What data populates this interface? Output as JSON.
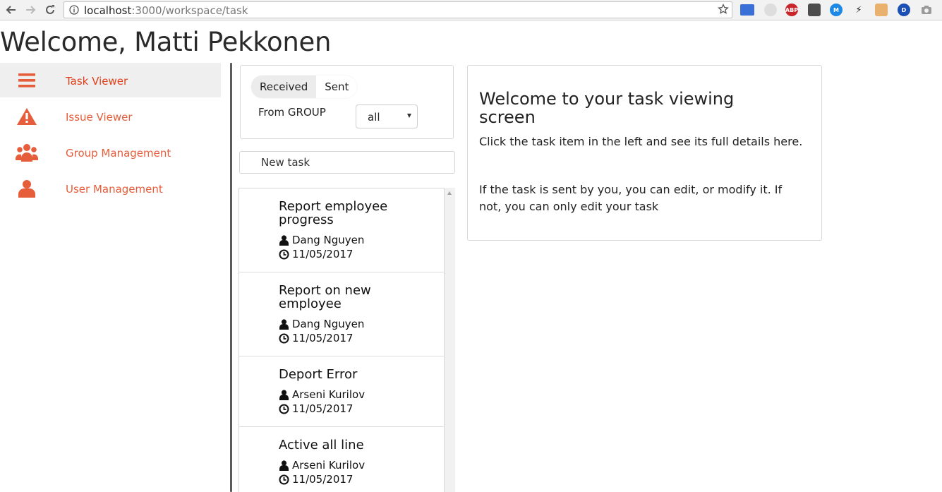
{
  "browser": {
    "url_host": "localhost",
    "url_path": ":3000/workspace/task",
    "extensions": [
      {
        "name": "abp",
        "label": "ABP",
        "color": "#c9262c"
      },
      {
        "name": "m",
        "label": "M",
        "color": "#1e88e5"
      },
      {
        "name": "d",
        "label": "D",
        "color": "#1a4fb5"
      }
    ]
  },
  "page": {
    "welcome": "Welcome, Matti Pekkonen"
  },
  "sidebar": {
    "items": [
      {
        "label": "Task Viewer",
        "icon": "hamburger-icon"
      },
      {
        "label": "Issue Viewer",
        "icon": "warning-icon"
      },
      {
        "label": "Group Management",
        "icon": "users-icon"
      },
      {
        "label": "User Management",
        "icon": "user-icon"
      }
    ],
    "accent_color": "#e55d3b"
  },
  "filter": {
    "tabs": [
      "Received",
      "Sent"
    ],
    "from_label": "From GROUP",
    "group_value": "all"
  },
  "new_task": {
    "placeholder": "New task"
  },
  "tasks": [
    {
      "title": "Report employee progress",
      "assignee": "Dang Nguyen",
      "date": "11/05/2017"
    },
    {
      "title": "Report on new employee",
      "assignee": "Dang Nguyen",
      "date": "11/05/2017"
    },
    {
      "title": "Deport Error",
      "assignee": "Arseni Kurilov",
      "date": "11/05/2017"
    },
    {
      "title": "Active all line",
      "assignee": "Arseni Kurilov",
      "date": "11/05/2017"
    }
  ],
  "detail": {
    "heading": "Welcome to your task viewing screen",
    "para1": "Click the task item in the left and see its full details here.",
    "para2": "If the task is sent by you, you can edit, or modify it. If not, you can only edit your task"
  }
}
